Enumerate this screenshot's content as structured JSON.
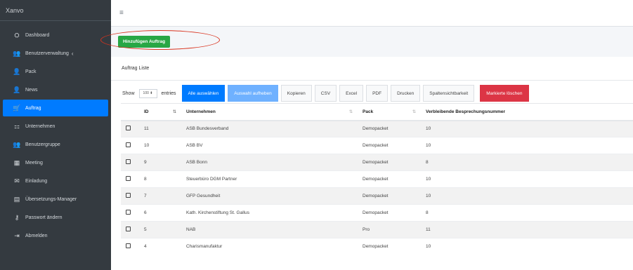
{
  "app": {
    "brand": "Xanvo"
  },
  "sidebar": {
    "items": [
      {
        "label": "Dashboard",
        "icon": "dashboard-icon",
        "glyph": "⛭"
      },
      {
        "label": "Benutzerverwaltung",
        "icon": "users-icon",
        "glyph": "👥",
        "caret": "‹"
      },
      {
        "label": "Pack",
        "icon": "pack-icon",
        "glyph": "👤"
      },
      {
        "label": "News",
        "icon": "news-icon",
        "glyph": "👤"
      },
      {
        "label": "Auftrag",
        "icon": "cart-icon",
        "glyph": "🛒",
        "active": true
      },
      {
        "label": "Unternehmen",
        "icon": "sitemap-icon",
        "glyph": "⚏"
      },
      {
        "label": "Benutzergruppe",
        "icon": "group-icon",
        "glyph": "👥"
      },
      {
        "label": "Meeting",
        "icon": "calendar-icon",
        "glyph": "▦"
      },
      {
        "label": "Einladung",
        "icon": "envelope-icon",
        "glyph": "✉"
      },
      {
        "label": "Übersetzungs-Manager",
        "icon": "translate-icon",
        "glyph": "▤"
      },
      {
        "label": "Passwort ändern",
        "icon": "key-icon",
        "glyph": "⚷"
      },
      {
        "label": "Abmelden",
        "icon": "logout-icon",
        "glyph": "⇥"
      }
    ]
  },
  "topbar": {
    "menu_glyph": "≡"
  },
  "actions": {
    "add_label": "Hinzufügen Auftrag"
  },
  "card": {
    "title": "Auftrag Liste"
  },
  "toolbar": {
    "show": "Show",
    "entries_value": "100 ⬍",
    "entries": "entries",
    "buttons": {
      "select_all": "Alle auswählen",
      "deselect": "Auswahl aufheben",
      "copy": "Kopieren",
      "csv": "CSV",
      "excel": "Excel",
      "pdf": "PDF",
      "print": "Drucken",
      "columns": "Spaltensichtbarkeit",
      "delete_marked": "Markierte löschen"
    }
  },
  "table": {
    "headers": {
      "id": "ID",
      "unternehmen": "Unternehmen",
      "pack": "Pack",
      "remaining": "Verbleibende Besprechungsnummer"
    },
    "sort_icons": {
      "id": "⇅",
      "unternehmen": "⇅",
      "pack": "⇅"
    },
    "rows": [
      {
        "id": "11",
        "unternehmen": "ASB Bundesverband",
        "pack": "Demopacket",
        "remaining": "10"
      },
      {
        "id": "10",
        "unternehmen": "ASB BV",
        "pack": "Demopacket",
        "remaining": "10"
      },
      {
        "id": "9",
        "unternehmen": "ASB Bonn",
        "pack": "Demopacket",
        "remaining": "8"
      },
      {
        "id": "8",
        "unternehmen": "Steuerbüro DGM Partner",
        "pack": "Demopacket",
        "remaining": "10"
      },
      {
        "id": "7",
        "unternehmen": "GFP Gesundheit",
        "pack": "Demopacket",
        "remaining": "10"
      },
      {
        "id": "6",
        "unternehmen": "Kath. Kirchenstiftung St. Gallus",
        "pack": "Demopacket",
        "remaining": "8"
      },
      {
        "id": "5",
        "unternehmen": "NAB",
        "pack": "Pro",
        "remaining": "11"
      },
      {
        "id": "4",
        "unternehmen": "Charismanufaktur",
        "pack": "Demopacket",
        "remaining": "10"
      }
    ]
  },
  "colors": {
    "sidebar_bg": "#343a40",
    "active": "#007bff",
    "add_button": "#28a745",
    "danger": "#dc3545",
    "highlight": "#d9331e"
  }
}
